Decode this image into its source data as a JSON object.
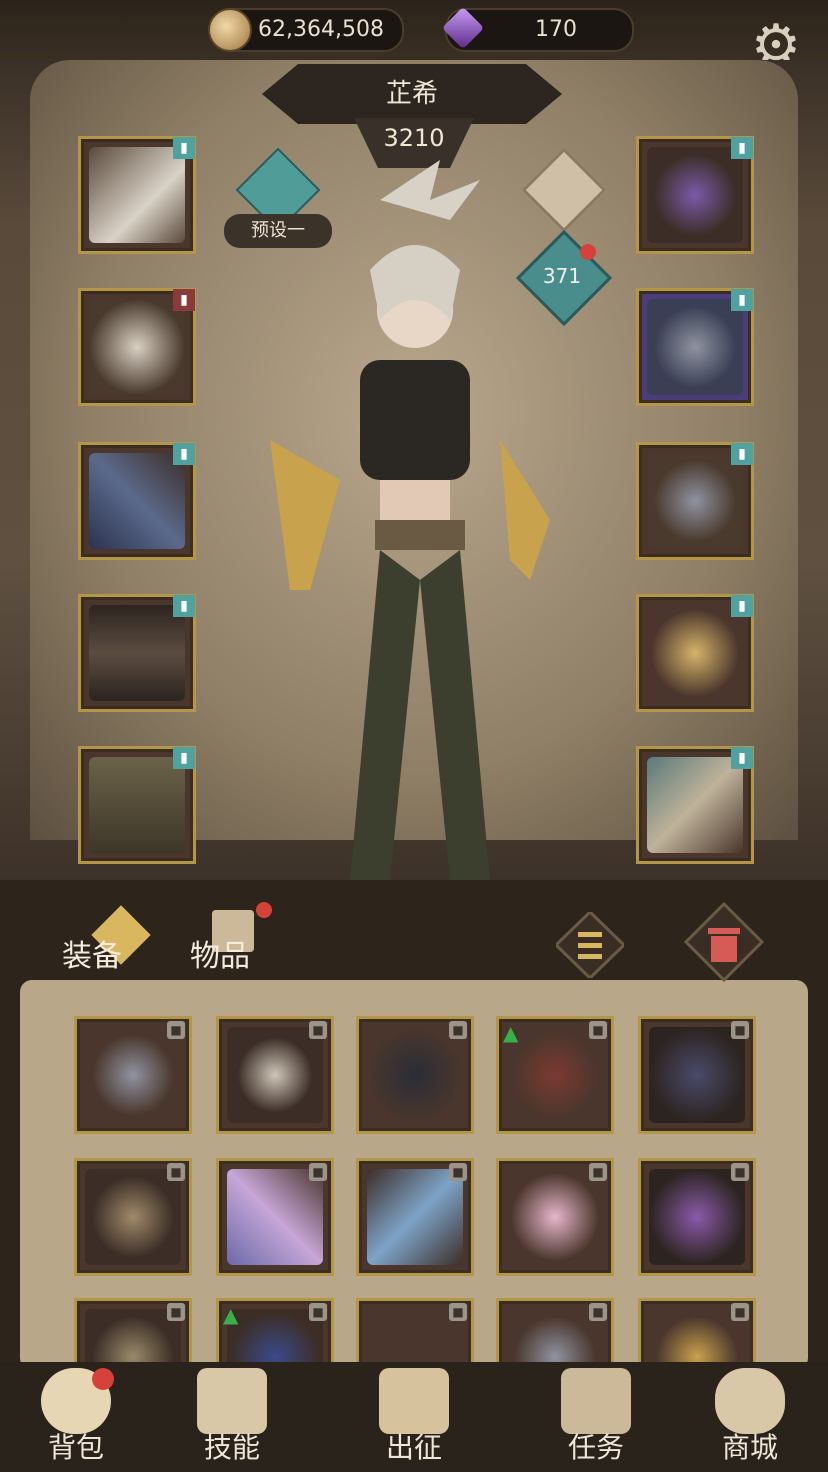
{
  "resources": {
    "gold": "62,364,508",
    "gems": "170"
  },
  "hero": {
    "name": "芷希",
    "power": "3210",
    "preset": "预设一",
    "level_badge": "371"
  },
  "tabs": {
    "equip": "装备",
    "items": "物品"
  },
  "nav": [
    {
      "label": "背包"
    },
    {
      "label": "技能"
    },
    {
      "label": "出征"
    },
    {
      "label": "任务"
    },
    {
      "label": "商城"
    }
  ],
  "colors": {
    "accent_teal": "#4fa2a0",
    "slot_gold": "#b49649",
    "red_dot": "#d6423a"
  }
}
